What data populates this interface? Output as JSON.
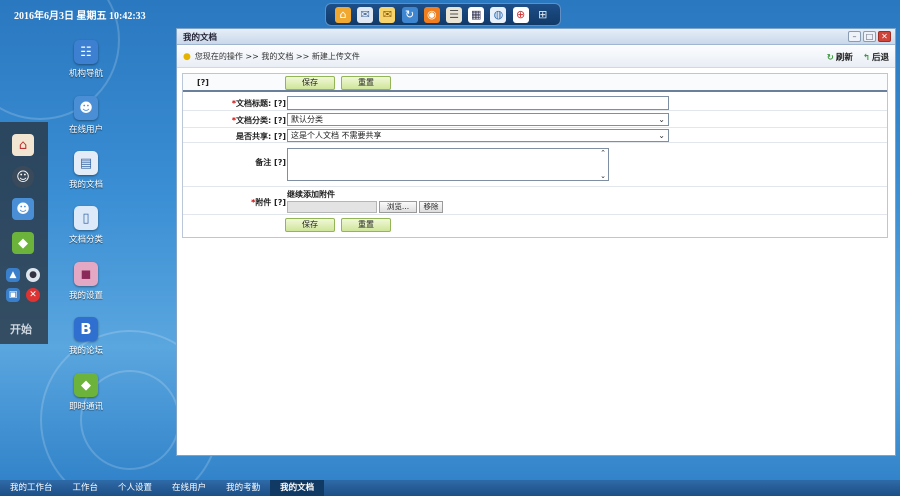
{
  "clock": "2016年6月3日 星期五 10:42:33",
  "quickbar": {
    "icons": [
      "home-icon",
      "mail-open-icon",
      "envelope-icon",
      "refresh-icon",
      "rss-icon",
      "notes-icon",
      "calendar-icon",
      "globe-icon",
      "lifebuoy-icon",
      "grid-icon"
    ]
  },
  "desktop": {
    "icons": [
      {
        "label": "机构导航",
        "icon": "org-icon"
      },
      {
        "label": "在线用户",
        "icon": "users-icon"
      },
      {
        "label": "我的文档",
        "icon": "document-icon"
      },
      {
        "label": "文档分类",
        "icon": "folder-icon"
      },
      {
        "label": "我的设置",
        "icon": "settings-icon"
      },
      {
        "label": "我的论坛",
        "icon": "forum-icon"
      },
      {
        "label": "即时通讯",
        "icon": "chat-icon"
      }
    ]
  },
  "dock": {
    "start_label": "开始"
  },
  "window": {
    "title": "我的文档",
    "breadcrumb": "您现在的操作 >> 我的文档 >> 新建上传文件",
    "refresh_label": "刷新",
    "back_label": "后退",
    "help_mark": "[?]",
    "save_label": "保存",
    "reset_label": "重置",
    "form": {
      "title_label": "文档标题:",
      "title_value": "",
      "category_label": "文档分类:",
      "category_value": "默认分类",
      "share_label": "是否共享:",
      "share_value": "这是个人文档 不需要共享",
      "note_label": "备注",
      "note_value": "",
      "attach_label": "附件",
      "attach_add": "继续添加附件",
      "browse_label": "浏览...",
      "remove_label": "移除",
      "required_mark": "*",
      "help": "[?]"
    }
  },
  "taskbar": {
    "items": [
      {
        "label": "我的工作台",
        "active": false
      },
      {
        "label": "工作台",
        "active": false
      },
      {
        "label": "个人设置",
        "active": false
      },
      {
        "label": "在线用户",
        "active": false
      },
      {
        "label": "我的考勤",
        "active": false
      },
      {
        "label": "我的文档",
        "active": true
      }
    ]
  }
}
